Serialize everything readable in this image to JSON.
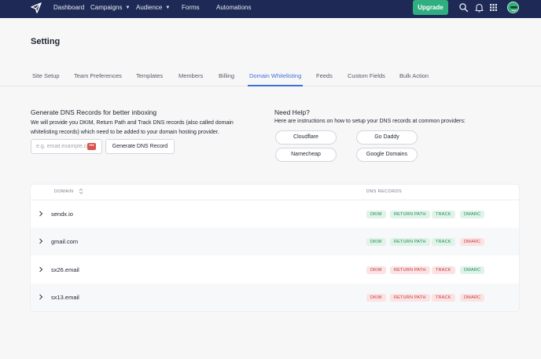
{
  "nav": {
    "items": [
      {
        "label": "Dashboard"
      },
      {
        "label": "Campaigns"
      },
      {
        "label": "Audience"
      },
      {
        "label": "Forms"
      },
      {
        "label": "Automations"
      }
    ],
    "upgrade_label": "Upgrade",
    "icons": [
      "search-icon",
      "bell-icon",
      "apps-grid-icon",
      "avatar"
    ]
  },
  "page": {
    "title": "Setting"
  },
  "tabs": [
    {
      "label": "Site Setup"
    },
    {
      "label": "Team Preferences"
    },
    {
      "label": "Templates"
    },
    {
      "label": "Members"
    },
    {
      "label": "Billing"
    },
    {
      "label": "Domain Whitelisting",
      "active": true
    },
    {
      "label": "Feeds"
    },
    {
      "label": "Custom Fields"
    },
    {
      "label": "Bulk Action"
    }
  ],
  "generate": {
    "title": "Generate DNS Records for better inboxing",
    "description": "We will provide you DKIM, Return Path and Track DNS records (also called domain whitelisting records) which need to be added to your domain hosting provider.",
    "input_placeholder": "e.g. email.example.com",
    "input_value": "",
    "button_label": "Generate DNS Record"
  },
  "help": {
    "title": "Need Help?",
    "description": "Here are instructions on how to setup your DNS records at common providers:",
    "providers": [
      {
        "label": "Cloudflare"
      },
      {
        "label": "Go Daddy"
      },
      {
        "label": "Namecheap"
      },
      {
        "label": "Google Domains"
      }
    ]
  },
  "table": {
    "columns": {
      "domain": "DOMAIN",
      "records": "DNS RECORDS"
    },
    "rows": [
      {
        "domain": "sendx.io",
        "records": [
          {
            "label": "DKIM",
            "status": "ok"
          },
          {
            "label": "RETURN PATH",
            "status": "ok"
          },
          {
            "label": "TRACK",
            "status": "ok"
          },
          {
            "label": "DMARC",
            "status": "ok"
          }
        ]
      },
      {
        "domain": "gmail.com",
        "records": [
          {
            "label": "DKIM",
            "status": "ok"
          },
          {
            "label": "RETURN PATH",
            "status": "ok"
          },
          {
            "label": "TRACK",
            "status": "ok"
          },
          {
            "label": "DMARC",
            "status": "bad"
          }
        ]
      },
      {
        "domain": "sx26.email",
        "records": [
          {
            "label": "DKIM",
            "status": "bad"
          },
          {
            "label": "RETURN PATH",
            "status": "bad"
          },
          {
            "label": "TRACK",
            "status": "bad"
          },
          {
            "label": "DMARC",
            "status": "ok"
          }
        ]
      },
      {
        "domain": "sx13.email",
        "records": [
          {
            "label": "DKIM",
            "status": "bad"
          },
          {
            "label": "RETURN PATH",
            "status": "bad"
          },
          {
            "label": "TRACK",
            "status": "bad"
          },
          {
            "label": "DMARC",
            "status": "bad"
          }
        ]
      }
    ]
  },
  "colors": {
    "nav_bg": "#1e2a55",
    "accent": "#3f6fd8",
    "upgrade": "#2fae7f",
    "ok_bg": "#dff3e8",
    "ok_text": "#228a57",
    "bad_bg": "#fbe3e3",
    "bad_text": "#c7373b"
  }
}
